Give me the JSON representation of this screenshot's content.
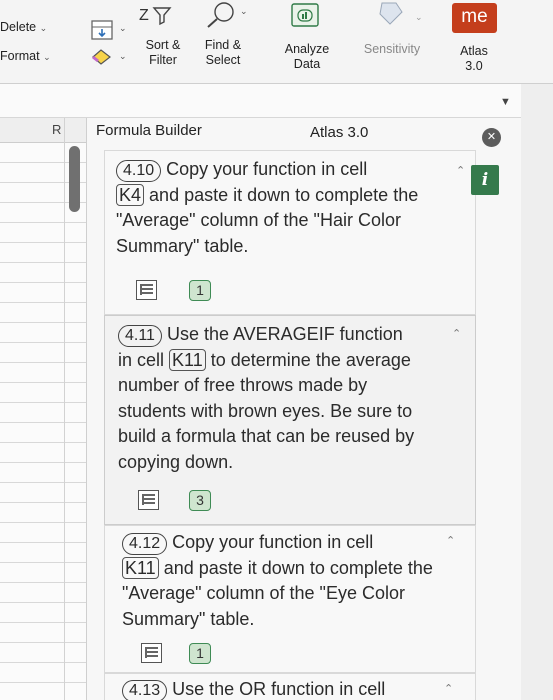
{
  "ribbon": {
    "delete_label": "Delete",
    "format_label": "Format",
    "sort_filter": [
      "Sort &",
      "Filter"
    ],
    "find_select": [
      "Find &",
      "Select"
    ],
    "analyze_data": [
      "Analyze",
      "Data"
    ],
    "sensitivity": "Sensitivity",
    "atlas": [
      "Atlas",
      "3.0"
    ],
    "me_label": "me"
  },
  "grid": {
    "column_header": "R"
  },
  "pane": {
    "title": "Formula Builder",
    "subtitle": "Atlas 3.0",
    "steps": [
      {
        "num": "4.10",
        "lines": [
          "Copy your function in cell",
          "and paste it down to complete the",
          "\"Average\" column of the \"Hair Color",
          "Summary\" table."
        ],
        "cell": "K4",
        "count": "1"
      },
      {
        "num": "4.11",
        "lines": [
          "Use the AVERAGEIF function",
          "in cell",
          "to determine the average",
          "number of free throws made by",
          "students with brown eyes. Be sure to",
          "build a formula that can be reused by",
          "copying down."
        ],
        "cell": "K11",
        "count": "3"
      },
      {
        "num": "4.12",
        "lines": [
          "Copy your function in cell",
          "and paste it down to complete the",
          "\"Average\" column of the \"Eye Color",
          "Summary\" table."
        ],
        "cell": "K11",
        "count": "1"
      },
      {
        "num": "4.13",
        "lines": [
          "Use the OR function in cell"
        ]
      }
    ]
  },
  "colors": {
    "accent_green": "#357a4c",
    "office_red": "#c43e1c"
  }
}
